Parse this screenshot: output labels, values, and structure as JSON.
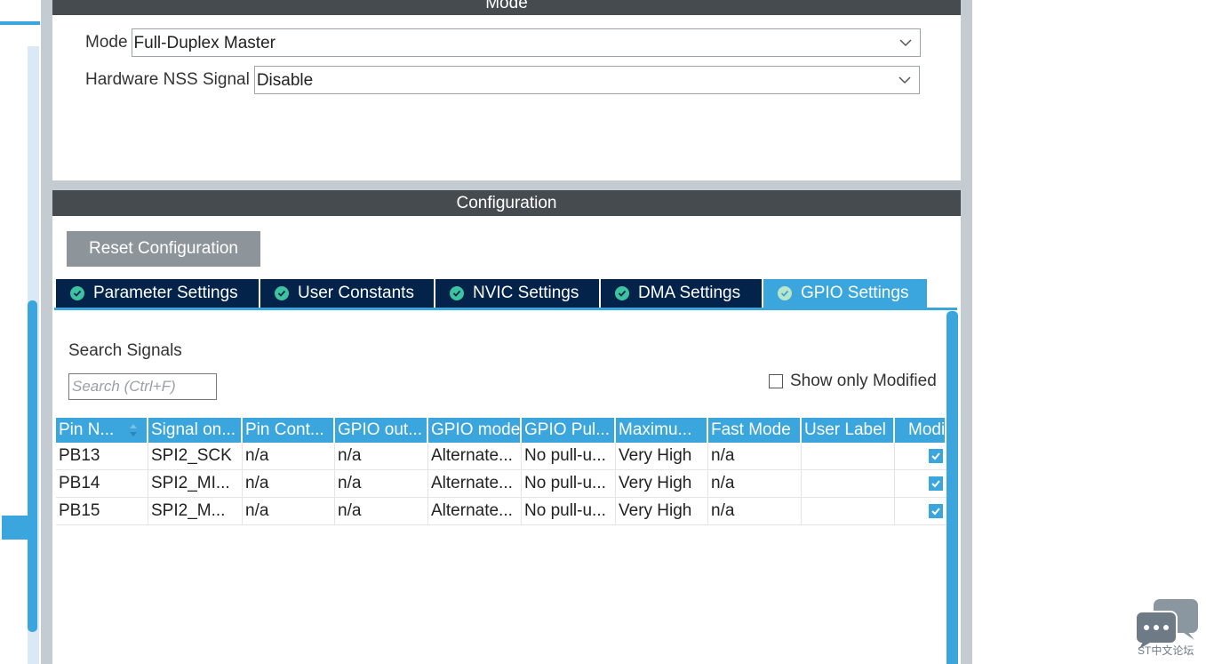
{
  "mode": {
    "header": "Mode",
    "mode_label": "Mode",
    "mode_value": "Full-Duplex Master",
    "nss_label": "Hardware NSS Signal",
    "nss_value": "Disable"
  },
  "configuration": {
    "header": "Configuration",
    "reset_label": "Reset Configuration",
    "tabs": [
      {
        "label": "Parameter Settings",
        "active": false
      },
      {
        "label": "User Constants",
        "active": false
      },
      {
        "label": "NVIC Settings",
        "active": false
      },
      {
        "label": "DMA Settings",
        "active": false
      },
      {
        "label": "GPIO Settings",
        "active": true
      }
    ],
    "search_label": "Search Signals",
    "search_placeholder": "Search (Ctrl+F)",
    "show_modified_label": "Show only Modified",
    "table": {
      "columns": [
        "Pin N...",
        "Signal on...",
        "Pin Cont...",
        "GPIO out...",
        "GPIO mode",
        "GPIO Pul...",
        "Maximu...",
        "Fast Mode",
        "User Label",
        "Modi"
      ],
      "rows": [
        [
          "PB13",
          "SPI2_SCK",
          "n/a",
          "n/a",
          "Alternate...",
          "No pull-u...",
          "Very High",
          "n/a",
          ""
        ],
        [
          "PB14",
          "SPI2_MI...",
          "n/a",
          "n/a",
          "Alternate...",
          "No pull-u...",
          "Very High",
          "n/a",
          ""
        ],
        [
          "PB15",
          "SPI2_M...",
          "n/a",
          "n/a",
          "Alternate...",
          "No pull-u...",
          "Very High",
          "n/a",
          ""
        ]
      ]
    }
  },
  "watermark": {
    "text": "ST中文论坛"
  },
  "colors": {
    "accent": "#3aa6dd",
    "dark_header": "#454b4f",
    "tab_dark": "#03234b"
  }
}
